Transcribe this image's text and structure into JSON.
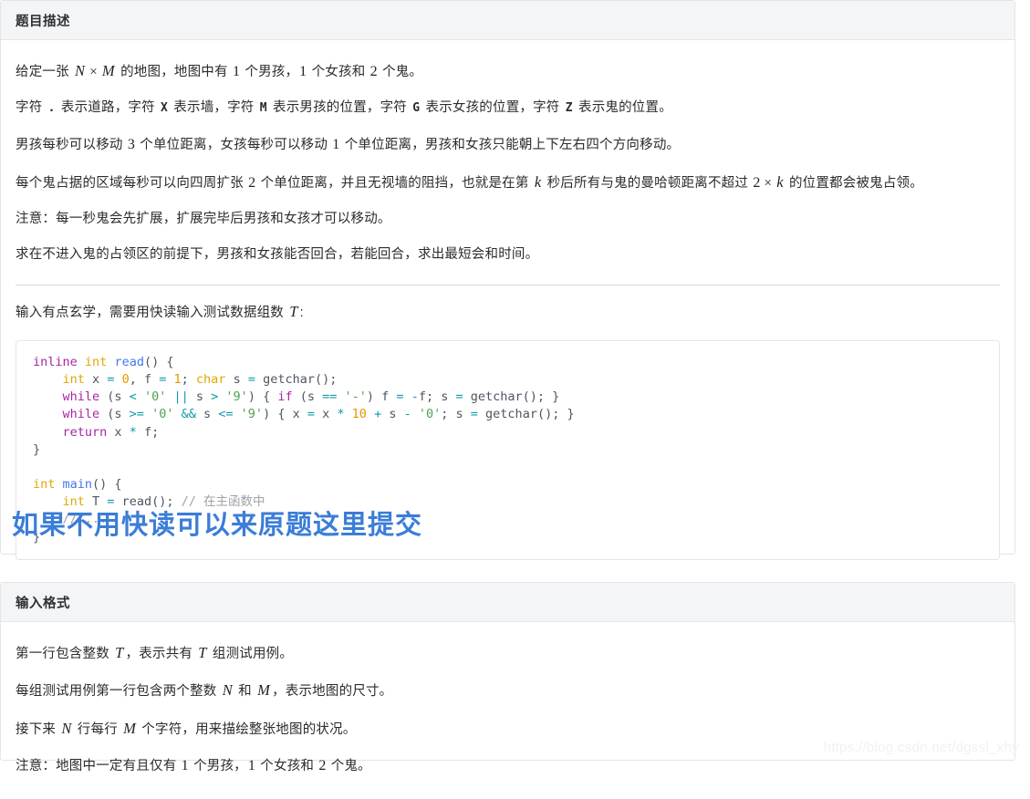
{
  "problem_card": {
    "header": "题目描述",
    "paragraphs": [
      {
        "id": "p1",
        "parts": [
          {
            "t": "text",
            "v": "给定一张 "
          },
          {
            "t": "mi",
            "v": "N"
          },
          {
            "t": "mo",
            "v": "×"
          },
          {
            "t": "mi",
            "v": "M"
          },
          {
            "t": "text",
            "v": " 的地图，地图中有 "
          },
          {
            "t": "mn",
            "v": "1"
          },
          {
            "t": "text",
            "v": " 个男孩，"
          },
          {
            "t": "mn",
            "v": "1"
          },
          {
            "t": "text",
            "v": " 个女孩和 "
          },
          {
            "t": "mn",
            "v": "2"
          },
          {
            "t": "text",
            "v": " 个鬼。"
          }
        ]
      },
      {
        "id": "p2",
        "parts": [
          {
            "t": "text",
            "v": "字符 "
          },
          {
            "t": "mono",
            "v": "."
          },
          {
            "t": "text",
            "v": " 表示道路，字符 "
          },
          {
            "t": "mono",
            "v": "X"
          },
          {
            "t": "text",
            "v": " 表示墙，字符 "
          },
          {
            "t": "mono",
            "v": "M"
          },
          {
            "t": "text",
            "v": " 表示男孩的位置，字符 "
          },
          {
            "t": "mono",
            "v": "G"
          },
          {
            "t": "text",
            "v": " 表示女孩的位置，字符 "
          },
          {
            "t": "mono",
            "v": "Z"
          },
          {
            "t": "text",
            "v": " 表示鬼的位置。"
          }
        ]
      },
      {
        "id": "p3",
        "parts": [
          {
            "t": "text",
            "v": "男孩每秒可以移动 "
          },
          {
            "t": "mn",
            "v": "3"
          },
          {
            "t": "text",
            "v": " 个单位距离，女孩每秒可以移动 "
          },
          {
            "t": "mn",
            "v": "1"
          },
          {
            "t": "text",
            "v": " 个单位距离，男孩和女孩只能朝上下左右四个方向移动。"
          }
        ]
      },
      {
        "id": "p4",
        "parts": [
          {
            "t": "text",
            "v": "每个鬼占据的区域每秒可以向四周扩张 "
          },
          {
            "t": "mn",
            "v": "2"
          },
          {
            "t": "text",
            "v": " 个单位距离，并且无视墙的阻挡，也就是在第 "
          },
          {
            "t": "mi",
            "v": "k"
          },
          {
            "t": "text",
            "v": " 秒后所有与鬼的曼哈顿距离不超过 "
          },
          {
            "t": "mn",
            "v": "2"
          },
          {
            "t": "mo",
            "v": "×"
          },
          {
            "t": "mi",
            "v": "k"
          },
          {
            "t": "text",
            "v": " 的位置都会被鬼占领。"
          }
        ]
      },
      {
        "id": "p5",
        "parts": [
          {
            "t": "text",
            "v": "注意：每一秒鬼会先扩展，扩展完毕后男孩和女孩才可以移动。"
          }
        ]
      },
      {
        "id": "p6",
        "parts": [
          {
            "t": "text",
            "v": "求在不进入鬼的占领区的前提下，男孩和女孩能否回合，若能回合，求出最短会和时间。"
          }
        ]
      }
    ],
    "after_hr_paragraph": {
      "id": "p7",
      "parts": [
        {
          "t": "text",
          "v": "输入有点玄学，需要用快读输入测试数据组数 "
        },
        {
          "t": "mi",
          "v": "T"
        },
        {
          "t": "text",
          "v": ":"
        }
      ]
    },
    "code": {
      "language": "cpp",
      "lines": [
        [
          {
            "c": "k",
            "v": "inline"
          },
          {
            "c": "pl",
            "v": " "
          },
          {
            "c": "ty",
            "v": "int"
          },
          {
            "c": "pl",
            "v": " "
          },
          {
            "c": "fn",
            "v": "read"
          },
          {
            "c": "pl",
            "v": "() {"
          }
        ],
        [
          {
            "c": "pl",
            "v": "    "
          },
          {
            "c": "ty",
            "v": "int"
          },
          {
            "c": "pl",
            "v": " x "
          },
          {
            "c": "op",
            "v": "="
          },
          {
            "c": "pl",
            "v": " "
          },
          {
            "c": "num",
            "v": "0"
          },
          {
            "c": "pl",
            "v": ", f "
          },
          {
            "c": "op",
            "v": "="
          },
          {
            "c": "pl",
            "v": " "
          },
          {
            "c": "num",
            "v": "1"
          },
          {
            "c": "pl",
            "v": "; "
          },
          {
            "c": "ty",
            "v": "char"
          },
          {
            "c": "pl",
            "v": " s "
          },
          {
            "c": "op",
            "v": "="
          },
          {
            "c": "pl",
            "v": " getchar();"
          }
        ],
        [
          {
            "c": "pl",
            "v": "    "
          },
          {
            "c": "k",
            "v": "while"
          },
          {
            "c": "pl",
            "v": " (s "
          },
          {
            "c": "op",
            "v": "<"
          },
          {
            "c": "pl",
            "v": " "
          },
          {
            "c": "str",
            "v": "'0'"
          },
          {
            "c": "pl",
            "v": " "
          },
          {
            "c": "op",
            "v": "||"
          },
          {
            "c": "pl",
            "v": " s "
          },
          {
            "c": "op",
            "v": ">"
          },
          {
            "c": "pl",
            "v": " "
          },
          {
            "c": "str",
            "v": "'9'"
          },
          {
            "c": "pl",
            "v": ") { "
          },
          {
            "c": "k",
            "v": "if"
          },
          {
            "c": "pl",
            "v": " (s "
          },
          {
            "c": "op",
            "v": "=="
          },
          {
            "c": "pl",
            "v": " "
          },
          {
            "c": "str",
            "v": "'-'"
          },
          {
            "c": "pl",
            "v": ") f "
          },
          {
            "c": "op",
            "v": "="
          },
          {
            "c": "pl",
            "v": " "
          },
          {
            "c": "op",
            "v": "-"
          },
          {
            "c": "pl",
            "v": "f; s "
          },
          {
            "c": "op",
            "v": "="
          },
          {
            "c": "pl",
            "v": " getchar(); }"
          }
        ],
        [
          {
            "c": "pl",
            "v": "    "
          },
          {
            "c": "k",
            "v": "while"
          },
          {
            "c": "pl",
            "v": " (s "
          },
          {
            "c": "op",
            "v": ">="
          },
          {
            "c": "pl",
            "v": " "
          },
          {
            "c": "str",
            "v": "'0'"
          },
          {
            "c": "pl",
            "v": " "
          },
          {
            "c": "op",
            "v": "&&"
          },
          {
            "c": "pl",
            "v": " s "
          },
          {
            "c": "op",
            "v": "<="
          },
          {
            "c": "pl",
            "v": " "
          },
          {
            "c": "str",
            "v": "'9'"
          },
          {
            "c": "pl",
            "v": ") { x "
          },
          {
            "c": "op",
            "v": "="
          },
          {
            "c": "pl",
            "v": " x "
          },
          {
            "c": "op",
            "v": "*"
          },
          {
            "c": "pl",
            "v": " "
          },
          {
            "c": "num",
            "v": "10"
          },
          {
            "c": "pl",
            "v": " "
          },
          {
            "c": "op",
            "v": "+"
          },
          {
            "c": "pl",
            "v": " s "
          },
          {
            "c": "op",
            "v": "-"
          },
          {
            "c": "pl",
            "v": " "
          },
          {
            "c": "str",
            "v": "'0'"
          },
          {
            "c": "pl",
            "v": "; s "
          },
          {
            "c": "op",
            "v": "="
          },
          {
            "c": "pl",
            "v": " getchar(); }"
          }
        ],
        [
          {
            "c": "pl",
            "v": "    "
          },
          {
            "c": "k",
            "v": "return"
          },
          {
            "c": "pl",
            "v": " x "
          },
          {
            "c": "op",
            "v": "*"
          },
          {
            "c": "pl",
            "v": " f;"
          }
        ],
        [
          {
            "c": "pl",
            "v": "}"
          }
        ],
        [
          {
            "c": "pl",
            "v": ""
          }
        ],
        [
          {
            "c": "ty",
            "v": "int"
          },
          {
            "c": "pl",
            "v": " "
          },
          {
            "c": "fn",
            "v": "main"
          },
          {
            "c": "pl",
            "v": "() {"
          }
        ],
        [
          {
            "c": "pl",
            "v": "    "
          },
          {
            "c": "ty",
            "v": "int"
          },
          {
            "c": "pl",
            "v": " T "
          },
          {
            "c": "op",
            "v": "="
          },
          {
            "c": "pl",
            "v": " read(); "
          },
          {
            "c": "cm",
            "v": "// 在主函数中"
          }
        ],
        [
          {
            "c": "pl",
            "v": "    "
          },
          {
            "c": "cm",
            "v": "// ..."
          }
        ],
        [
          {
            "c": "pl",
            "v": "}"
          }
        ]
      ]
    }
  },
  "blue_heading": "如果不用快读可以来原题这里提交",
  "input_card": {
    "header": "输入格式",
    "paragraphs": [
      {
        "id": "i1",
        "parts": [
          {
            "t": "text",
            "v": "第一行包含整数 "
          },
          {
            "t": "mi",
            "v": "T"
          },
          {
            "t": "text",
            "v": "，表示共有 "
          },
          {
            "t": "mi",
            "v": "T"
          },
          {
            "t": "text",
            "v": " 组测试用例。"
          }
        ]
      },
      {
        "id": "i2",
        "parts": [
          {
            "t": "text",
            "v": "每组测试用例第一行包含两个整数 "
          },
          {
            "t": "mi",
            "v": "N"
          },
          {
            "t": "text",
            "v": " 和 "
          },
          {
            "t": "mi",
            "v": "M"
          },
          {
            "t": "text",
            "v": "，表示地图的尺寸。"
          }
        ]
      },
      {
        "id": "i3",
        "parts": [
          {
            "t": "text",
            "v": "接下来 "
          },
          {
            "t": "mi",
            "v": "N"
          },
          {
            "t": "text",
            "v": " 行每行 "
          },
          {
            "t": "mi",
            "v": "M"
          },
          {
            "t": "text",
            "v": " 个字符，用来描绘整张地图的状况。"
          }
        ]
      },
      {
        "id": "i4",
        "parts": [
          {
            "t": "text",
            "v": "注意：地图中一定有且仅有 "
          },
          {
            "t": "mn",
            "v": "1"
          },
          {
            "t": "text",
            "v": " 个男孩，"
          },
          {
            "t": "mn",
            "v": "1"
          },
          {
            "t": "text",
            "v": " 个女孩和 "
          },
          {
            "t": "mn",
            "v": "2"
          },
          {
            "t": "text",
            "v": " 个鬼。"
          }
        ]
      }
    ]
  },
  "watermark": "https://blog.csdn.net/dgssl_xhy",
  "colors": {
    "heading_blue": "#3b7dd8",
    "card_header_bg": "#f4f5f7",
    "card_border": "#e3e5e8",
    "code_keyword": "#a626a4",
    "code_type": "#e0a800",
    "code_function": "#4078f2",
    "code_number": "#e59700",
    "code_operator": "#0f9aa8",
    "code_comment": "#a0a1a7"
  }
}
